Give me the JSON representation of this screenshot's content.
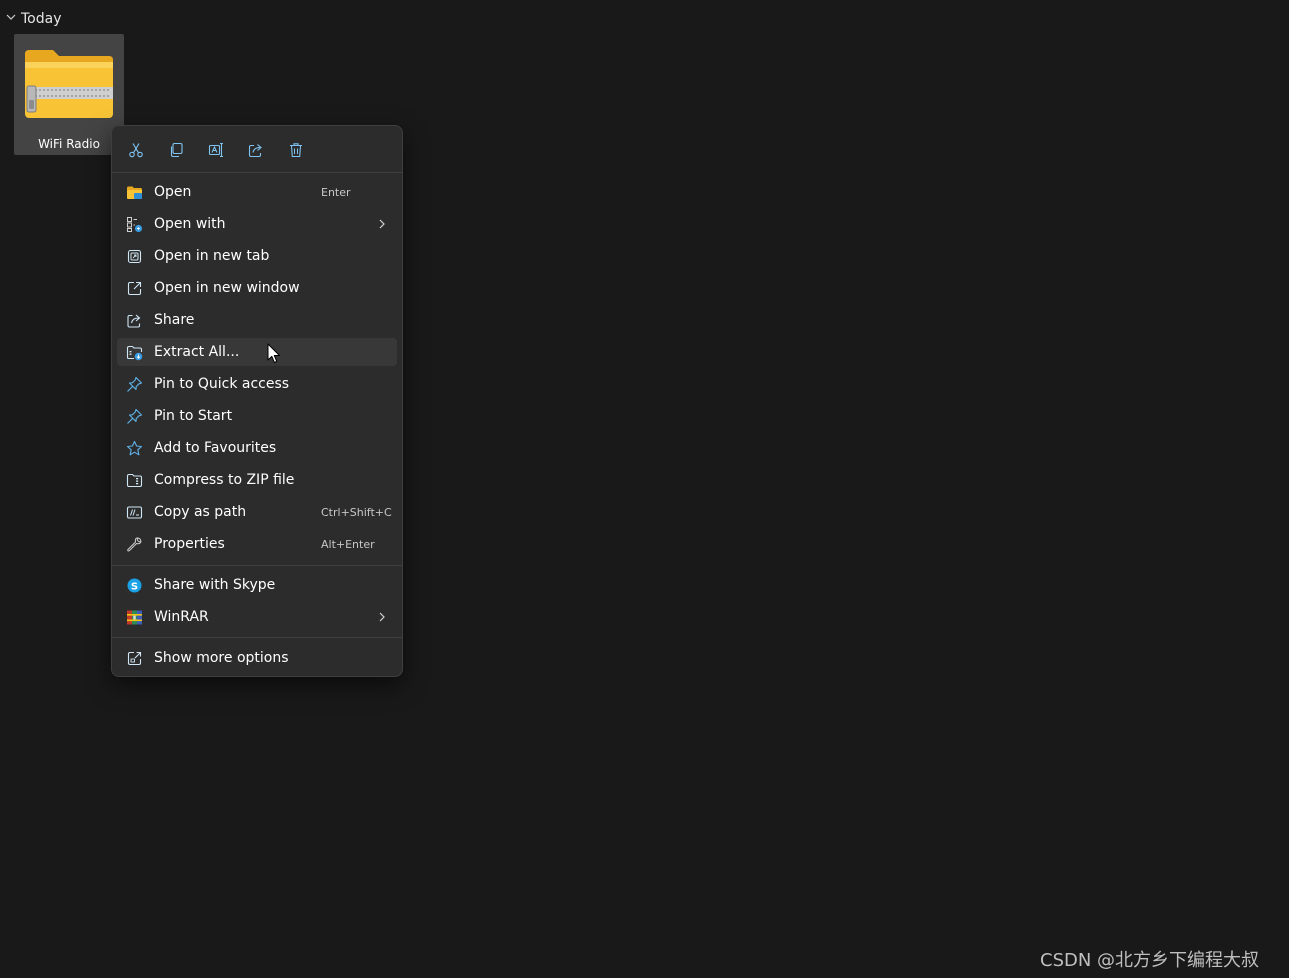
{
  "group": {
    "label": "Today"
  },
  "file": {
    "name": "WiFi Radio",
    "icon": "zip-folder-icon"
  },
  "quick_actions": [
    {
      "name": "cut",
      "icon": "scissors-icon"
    },
    {
      "name": "copy",
      "icon": "copy-icon"
    },
    {
      "name": "rename",
      "icon": "rename-icon"
    },
    {
      "name": "share",
      "icon": "share-icon"
    },
    {
      "name": "delete",
      "icon": "trash-icon"
    }
  ],
  "menu": {
    "items": [
      {
        "label": "Open",
        "shortcut": "Enter",
        "icon": "folder-icon"
      },
      {
        "label": "Open with",
        "shortcut": "",
        "icon": "open-with-icon",
        "submenu": true
      },
      {
        "label": "Open in new tab",
        "shortcut": "",
        "icon": "new-tab-icon"
      },
      {
        "label": "Open in new window",
        "shortcut": "",
        "icon": "new-window-icon"
      },
      {
        "label": "Share",
        "shortcut": "",
        "icon": "share-icon"
      },
      {
        "label": "Extract All...",
        "shortcut": "",
        "icon": "extract-icon",
        "highlighted": true
      },
      {
        "label": "Pin to Quick access",
        "shortcut": "",
        "icon": "pin-icon"
      },
      {
        "label": "Pin to Start",
        "shortcut": "",
        "icon": "pin-icon"
      },
      {
        "label": "Add to Favourites",
        "shortcut": "",
        "icon": "star-icon"
      },
      {
        "label": "Compress to ZIP file",
        "shortcut": "",
        "icon": "zip-icon"
      },
      {
        "label": "Copy as path",
        "shortcut": "Ctrl+Shift+C",
        "icon": "copy-path-icon"
      },
      {
        "label": "Properties",
        "shortcut": "Alt+Enter",
        "icon": "wrench-icon"
      },
      {
        "label": "Share with Skype",
        "shortcut": "",
        "icon": "skype-icon"
      },
      {
        "label": "WinRAR",
        "shortcut": "",
        "icon": "winrar-icon",
        "submenu": true
      },
      {
        "label": "Show more options",
        "shortcut": "",
        "icon": "more-options-icon"
      }
    ]
  },
  "watermark": "CSDN @北方乡下编程大叔",
  "colors": {
    "background": "#191919",
    "menu_bg": "#2c2c2c",
    "menu_hover": "#383838",
    "accent_blue": "#60cdff",
    "folder_yellow": "#f8c436"
  }
}
